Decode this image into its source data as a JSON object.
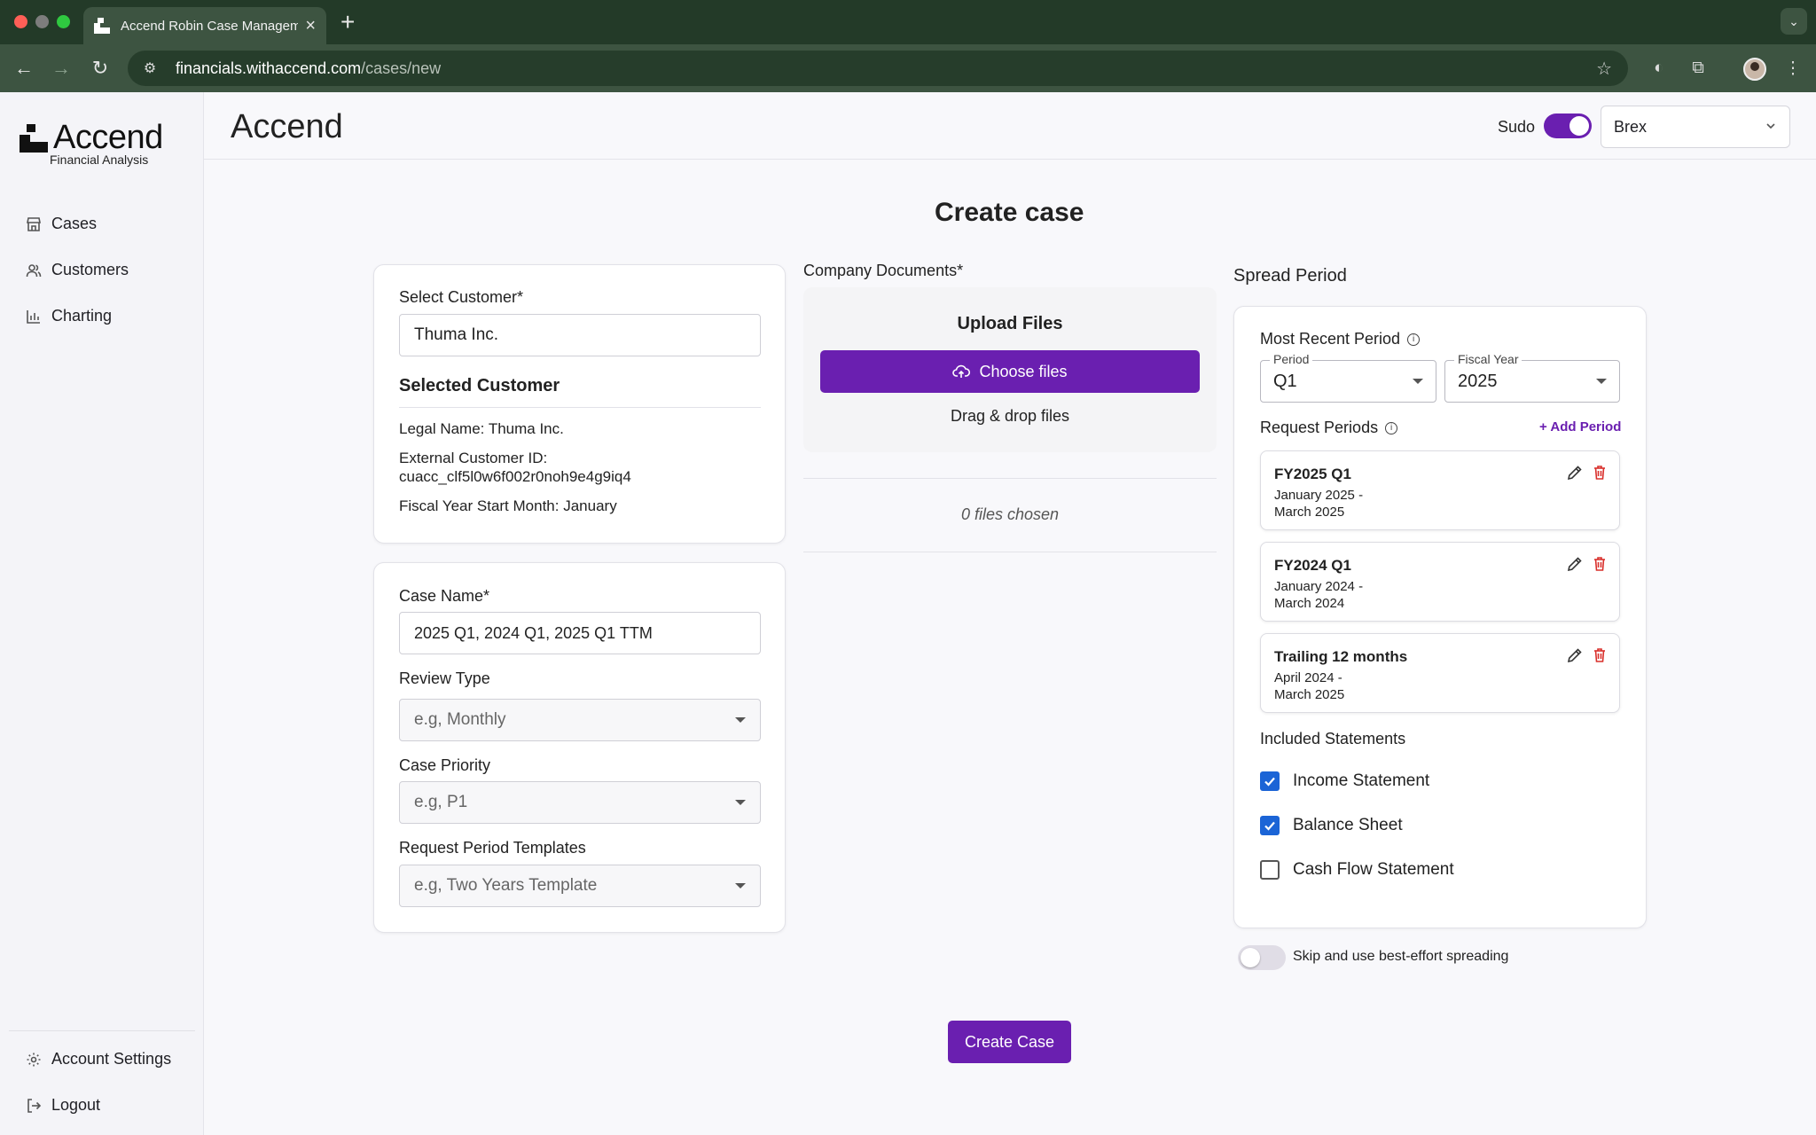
{
  "browser": {
    "tab_title": "Accend Robin Case Management",
    "url_host": "financials.withaccend.com",
    "url_path": "/cases/new"
  },
  "sidebar": {
    "logo_text": "Accend",
    "logo_sub": "Financial Analysis",
    "items": [
      {
        "label": "Cases",
        "icon": "store-icon"
      },
      {
        "label": "Customers",
        "icon": "users-icon"
      },
      {
        "label": "Charting",
        "icon": "bar-chart-icon"
      }
    ],
    "footer": [
      {
        "label": "Account Settings",
        "icon": "gear-icon"
      },
      {
        "label": "Logout",
        "icon": "logout-icon"
      }
    ]
  },
  "header": {
    "title": "Accend",
    "sudo_label": "Sudo",
    "sudo_enabled": true,
    "org_selected": "Brex"
  },
  "page": {
    "title": "Create case"
  },
  "customer": {
    "select_label": "Select Customer*",
    "input_value": "Thuma Inc.",
    "selected_heading": "Selected Customer",
    "legal_name_label": "Legal Name:",
    "legal_name_value": "Thuma Inc.",
    "external_id_label": "External Customer ID:",
    "external_id_value": "cuacc_clf5l0w6f002r0noh9e4g9iq4",
    "fiscal_start_label": "Fiscal Year Start Month:",
    "fiscal_start_value": "January"
  },
  "case_form": {
    "case_name_label": "Case Name*",
    "case_name_value": "2025 Q1, 2024 Q1, 2025 Q1 TTM",
    "review_type_label": "Review Type",
    "review_type_placeholder": "e.g, Monthly",
    "priority_label": "Case Priority",
    "priority_placeholder": "e.g, P1",
    "templates_label": "Request Period Templates",
    "templates_placeholder": "e.g, Two Years Template"
  },
  "documents": {
    "label": "Company Documents*",
    "upload_title": "Upload Files",
    "choose_label": "Choose files",
    "drag_text": "Drag & drop files",
    "files_chosen": "0 files chosen"
  },
  "spread": {
    "title": "Spread Period",
    "most_recent_label": "Most Recent Period",
    "period_legend": "Period",
    "period_value": "Q1",
    "fiscal_year_legend": "Fiscal Year",
    "fiscal_year_value": "2025",
    "request_periods_label": "Request Periods",
    "add_period_label": "+ Add Period",
    "periods": [
      {
        "name": "FY2025 Q1",
        "range_start": "January 2025 -",
        "range_end": "March 2025"
      },
      {
        "name": "FY2024 Q1",
        "range_start": "January 2024 -",
        "range_end": "March 2024"
      },
      {
        "name": "Trailing 12 months",
        "range_start": "April 2024 -",
        "range_end": "March 2025"
      }
    ],
    "included_label": "Included Statements",
    "statements": [
      {
        "label": "Income Statement",
        "checked": true
      },
      {
        "label": "Balance Sheet",
        "checked": true
      },
      {
        "label": "Cash Flow Statement",
        "checked": false
      }
    ],
    "skip_label": "Skip and use best-effort spreading",
    "skip_enabled": false
  },
  "actions": {
    "create_label": "Create Case"
  },
  "colors": {
    "accent": "#6a1fb0",
    "checkbox": "#1b64d6",
    "delete": "#d9302c"
  }
}
